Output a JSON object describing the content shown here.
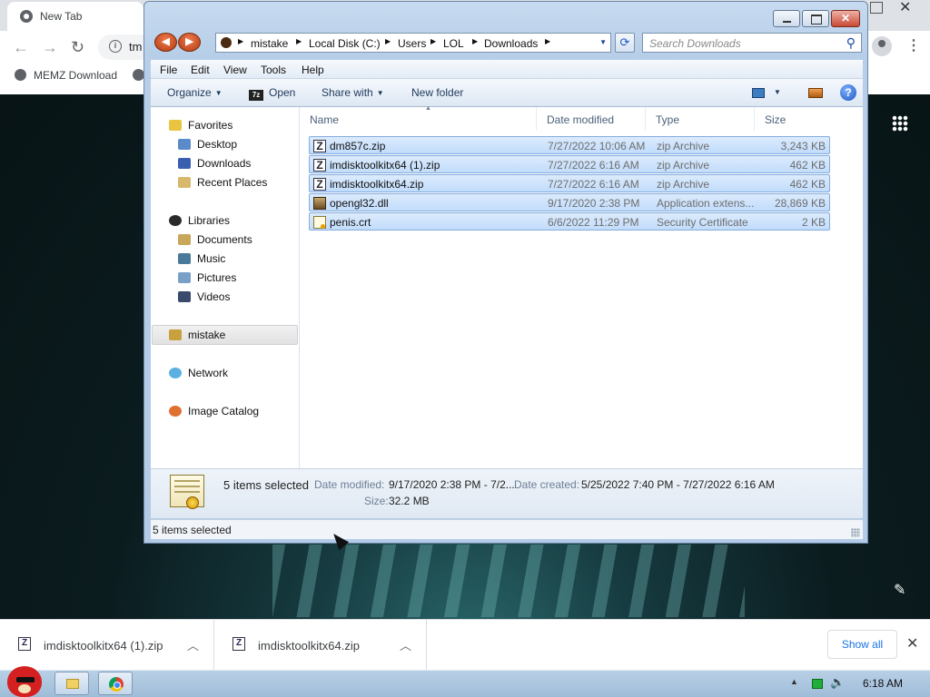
{
  "browser": {
    "tab_title": "New Tab",
    "address_partial": "tm",
    "bookmark": "MEMZ Download"
  },
  "downloads_shelf": {
    "items": [
      {
        "name": "imdisktoolkitx64 (1).zip",
        "icon": "zip-archive-icon"
      },
      {
        "name": "imdisktoolkitx64.zip",
        "icon": "zip-archive-icon"
      }
    ],
    "show_all_label": "Show all"
  },
  "explorer": {
    "breadcrumbs": [
      "mistake",
      "Local Disk (C:)",
      "Users",
      "LOL",
      "Downloads"
    ],
    "search_placeholder": "Search Downloads",
    "menu": [
      "File",
      "Edit",
      "View",
      "Tools",
      "Help"
    ],
    "toolbar": {
      "organize": "Organize",
      "open": "Open",
      "open_icon_text": "7z",
      "share_with": "Share with",
      "new_folder": "New folder"
    },
    "nav": {
      "favorites": "Favorites",
      "desktop": "Desktop",
      "downloads": "Downloads",
      "recent_places": "Recent Places",
      "libraries": "Libraries",
      "documents": "Documents",
      "music": "Music",
      "pictures": "Pictures",
      "videos": "Videos",
      "homegroup": "mistake",
      "network": "Network",
      "image_catalog": "Image Catalog"
    },
    "columns": {
      "name": "Name",
      "date": "Date modified",
      "type": "Type",
      "size": "Size"
    },
    "files": [
      {
        "name": "dm857c.zip",
        "date": "7/27/2022 10:06 AM",
        "type": "zip Archive",
        "size": "3,243 KB",
        "icon": "zip-archive-icon",
        "icon_text": "Z"
      },
      {
        "name": "imdisktoolkitx64 (1).zip",
        "date": "7/27/2022 6:16 AM",
        "type": "zip Archive",
        "size": "462 KB",
        "icon": "zip-archive-icon",
        "icon_text": "Z"
      },
      {
        "name": "imdisktoolkitx64.zip",
        "date": "7/27/2022 6:16 AM",
        "type": "zip Archive",
        "size": "462 KB",
        "icon": "zip-archive-icon",
        "icon_text": "Z"
      },
      {
        "name": "opengl32.dll",
        "date": "9/17/2020 2:38 PM",
        "type": "Application extens...",
        "size": "28,869 KB",
        "icon": "dll-file-icon",
        "icon_text": ""
      },
      {
        "name": "penis.crt",
        "date": "6/6/2022 11:29 PM",
        "type": "Security Certificate",
        "size": "2 KB",
        "icon": "certificate-icon",
        "icon_text": ""
      }
    ],
    "details": {
      "count": "5 items selected",
      "date_modified_label": "Date modified:",
      "date_modified_value": "9/17/2020 2:38 PM - 7/2...",
      "date_created_label": "Date created:",
      "date_created_value": "5/25/2022 7:40 PM - 7/27/2022 6:16 AM",
      "size_label": "Size:",
      "size_value": "32.2 MB"
    },
    "status": "5 items selected"
  },
  "taskbar": {
    "clock": "6:18 AM"
  }
}
